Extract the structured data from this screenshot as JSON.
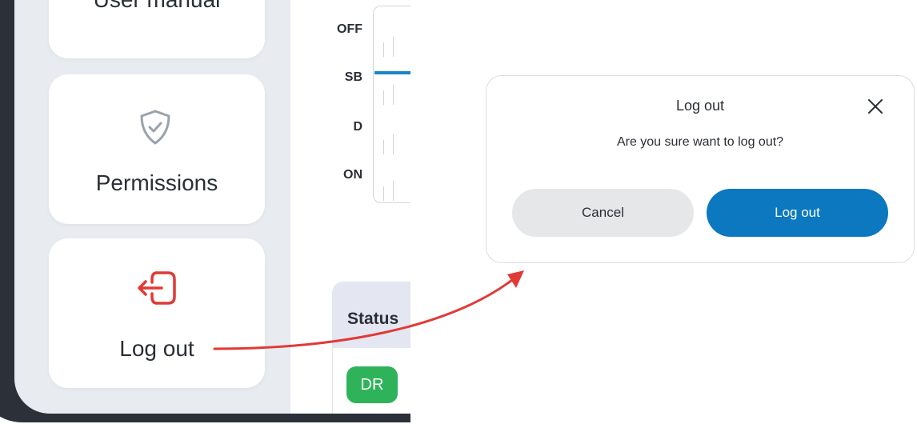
{
  "menu": {
    "user_manual_label": "User manual",
    "permissions_label": "Permissions",
    "logout_label": "Log out",
    "icons": {
      "permissions": "shield-check-icon",
      "logout": "logout-arrow-icon"
    }
  },
  "log_chart": {
    "row_labels": [
      "OFF",
      "SB",
      "D",
      "ON"
    ],
    "active_status": "SB",
    "line_color": "#1a85c5"
  },
  "status_panel": {
    "header": "Status",
    "badge": "DR",
    "badge_color": "#2fb35a"
  },
  "dialog": {
    "title": "Log out",
    "message": "Are you sure want to log out?",
    "cancel_label": "Cancel",
    "confirm_label": "Log out",
    "confirm_color": "#0b78c0",
    "close_icon": "close-icon"
  },
  "annotation": {
    "arrow_color": "#e03a36"
  }
}
